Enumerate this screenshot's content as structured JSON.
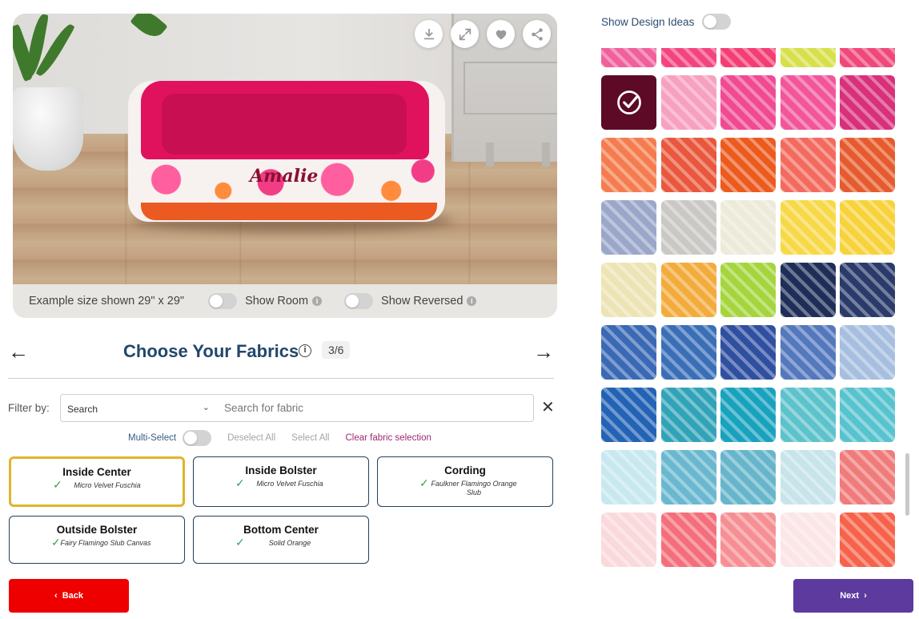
{
  "preview": {
    "bed_name": "Amalie",
    "size_text": "Example size shown 29\" x 29\"",
    "show_room_label": "Show Room",
    "show_reversed_label": "Show Reversed",
    "actions": [
      "download-icon",
      "expand-icon",
      "heart-icon",
      "share-icon"
    ]
  },
  "chooser": {
    "title": "Choose Your Fabrics",
    "step": "3/6",
    "prev_icon": "←",
    "next_icon": "→"
  },
  "filter": {
    "label": "Filter by:",
    "select_value": "Search",
    "search_placeholder": "Search for fabric",
    "clear_icon": "✕"
  },
  "selection_controls": {
    "multi_select": "Multi-Select",
    "deselect_all": "Deselect All",
    "select_all": "Select All",
    "clear_selection": "Clear fabric selection"
  },
  "fabric_cards": [
    {
      "title": "Inside Center",
      "fabric": "Micro Velvet Fuschia",
      "active": true
    },
    {
      "title": "Inside Bolster",
      "fabric": "Micro Velvet Fuschia",
      "active": false
    },
    {
      "title": "Cording",
      "fabric": "Faulkner Flamingo Orange Slub",
      "active": false
    },
    {
      "title": "Outside Bolster",
      "fabric": "Fairy Flamingo Slub Canvas",
      "active": false
    },
    {
      "title": "Bottom Center",
      "fabric": "Solid Orange",
      "active": false
    }
  ],
  "buttons": {
    "back": "Back",
    "next": "Next"
  },
  "design_ideas_label": "Show Design Ideas",
  "colors": {
    "title": "#22476b",
    "active_card_border": "#e0b42c",
    "card_border": "#23405e",
    "back_button": "#ee0000",
    "next_button": "#5c3a9e",
    "clear_link": "#9c2a72"
  },
  "swatch_rows": [
    [
      "#f0609b",
      "#f4447f",
      "#f43d74",
      "#d7e04a",
      "#f0487a"
    ],
    [
      "#5c0a25",
      "#f7a0c0",
      "#f04a92",
      "#f2559a",
      "#d8307a"
    ],
    [
      "#f57c4e",
      "#e9573c",
      "#ec5a1e",
      "#f36a5e",
      "#e65b2d"
    ],
    [
      "#9aa7c9",
      "#c9c8c4",
      "#ecead9",
      "#f7d948",
      "#f8d23a"
    ],
    [
      "#ece4b4",
      "#f3ab3c",
      "#a4d53c",
      "#1f2e58",
      "#2a3a6a"
    ],
    [
      "#3a69b5",
      "#3a6fb8",
      "#2f4fa0",
      "#5378bd",
      "#a6bedf"
    ],
    [
      "#2363b5",
      "#31a3b8",
      "#19a2be",
      "#5cc2cc",
      "#57c3cf"
    ],
    [
      "#c7e8ef",
      "#6ab8cf",
      "#66b5cb",
      "#c6e4ea",
      "#f07b7b"
    ],
    [
      "#fad9dc",
      "#f46f7b",
      "#f68f94",
      "#fbe5e7",
      "#f6634a"
    ]
  ],
  "selected_swatch_icon": "check-circle-icon"
}
